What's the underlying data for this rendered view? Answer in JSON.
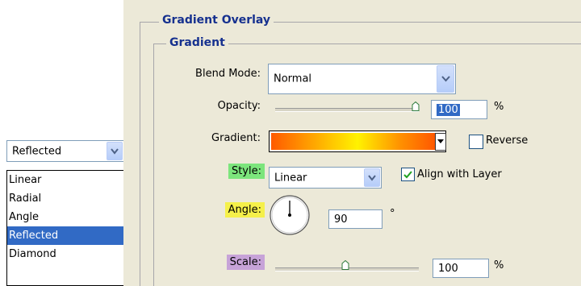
{
  "panel": {
    "section_title": "Gradient Overlay",
    "subsection_title": "Gradient",
    "blend_mode": {
      "label": "Blend Mode:",
      "value": "Normal"
    },
    "opacity": {
      "label": "Opacity:",
      "value": "100",
      "unit": "%",
      "level": 1.0
    },
    "gradient": {
      "label": "Gradient:",
      "colors": [
        "#ff5a00",
        "#ffc600",
        "#fff200",
        "#ff9000",
        "#ff4a00"
      ]
    },
    "reverse": {
      "label": "Reverse",
      "checked": false
    },
    "style": {
      "label": "Style:",
      "value": "Linear",
      "highlight": "#7ce57c"
    },
    "align": {
      "label": "Align with Layer",
      "checked": true
    },
    "angle": {
      "label": "Angle:",
      "value": "90",
      "unit": "°",
      "highlight": "#f5f04a"
    },
    "scale": {
      "label": "Scale:",
      "value": "100",
      "unit": "%",
      "level": 0.5,
      "highlight": "#c7a3d8"
    }
  },
  "style_dropdown": {
    "selected": "Reflected",
    "options": [
      "Linear",
      "Radial",
      "Angle",
      "Reflected",
      "Diamond"
    ],
    "highlight_color": "#316ac5"
  }
}
